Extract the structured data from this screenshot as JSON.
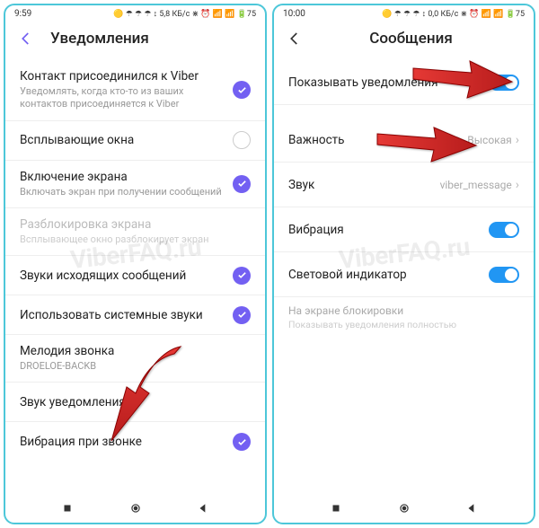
{
  "watermark": "ViberFAQ.ru",
  "left": {
    "status": {
      "time": "9:59",
      "icons": "🟡 ☂ ☂ ☂ ↕  5,8 КБ/с ⋇ ⏰ 📶 📶 🔋75"
    },
    "title": "Уведомления",
    "rows": {
      "contact": {
        "label": "Контакт присоединился к Viber",
        "sub": "Уведомлять, когда кто-то из ваших контактов присоединяется к Viber"
      },
      "popup": {
        "label": "Всплывающие окна"
      },
      "screen": {
        "label": "Включение экрана",
        "sub": "Включать экран при получении сообщений"
      },
      "unlock": {
        "label": "Разблокировка экрана",
        "sub": "Всплывающее окно разблокирует экран"
      },
      "outsnd": {
        "label": "Звуки исходящих сообщений"
      },
      "syssnd": {
        "label": "Использовать системные звуки"
      },
      "ring": {
        "label": "Мелодия звонка",
        "sub": "DROELOE-BACKB"
      },
      "notif": {
        "label": "Звук уведомления"
      },
      "vibr": {
        "label": "Вибрация при звонке"
      }
    }
  },
  "right": {
    "status": {
      "time": "10:00",
      "icons": "🟡 ☂ ☂ ☂ ↕  0,0 КБ/с ⋇ ⏰ 📶 📶 🔋75"
    },
    "title": "Сообщения",
    "rows": {
      "show": {
        "label": "Показывать уведомления"
      },
      "prio": {
        "label": "Важность",
        "value": "Высокая"
      },
      "sound": {
        "label": "Звук",
        "value": "viber_message"
      },
      "vibr": {
        "label": "Вибрация"
      },
      "light": {
        "label": "Световой индикатор"
      },
      "lock": {
        "label": "На экране блокировки",
        "sub": "Показывать уведомления полностью"
      }
    }
  }
}
